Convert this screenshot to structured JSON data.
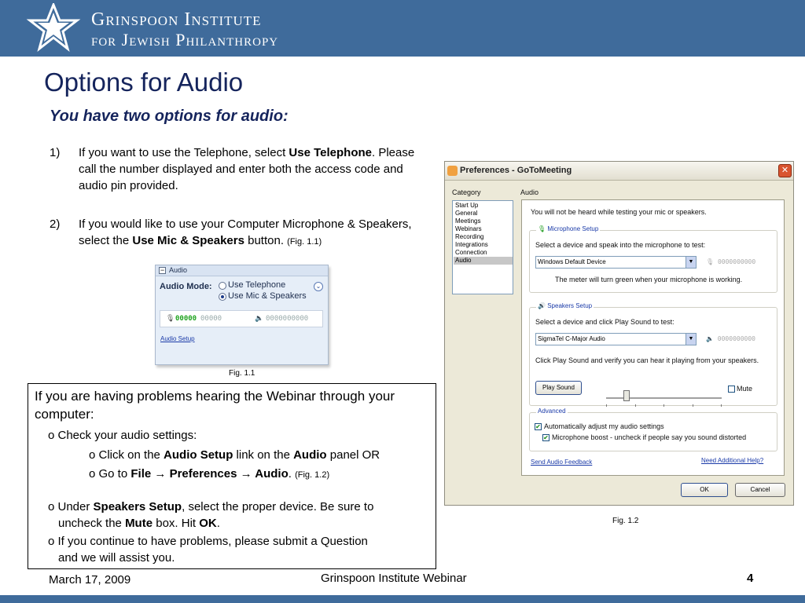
{
  "header": {
    "org_line1": "Grinspoon Institute",
    "org_line2": "for Jewish Philanthropy",
    "brand_color": "#3f6b9b"
  },
  "slide": {
    "title": "Options for Audio",
    "subtitle": "You have two options for audio:"
  },
  "options": [
    {
      "num": "1)",
      "pre": "If you want to use the Telephone, select ",
      "bold": "Use Telephone",
      "post": ".  Please call the number displayed and enter both the access code and audio pin provided."
    },
    {
      "num": "2)",
      "pre": "If you would like to use your Computer Microphone & Speakers, select the ",
      "bold": "Use Mic & Speakers",
      "post": " button. ",
      "fig_ref": "(Fig. 1.1)"
    }
  ],
  "fig11": {
    "panel_title": "Audio",
    "mode_label": "Audio Mode:",
    "option_telephone": "Use Telephone",
    "option_mic": "Use Mic & Speakers",
    "mic_meter": "00000",
    "mic_meter_active": "00000",
    "speaker_meter": "0000000000",
    "link": "Audio Setup",
    "caption": "Fig. 1.1"
  },
  "infobox": {
    "intro": "If you are having problems hearing the Webinar through your computer:",
    "check": "o Check your audio settings:",
    "sub1_pre": "o Click on the ",
    "sub1_b1": "Audio Setup",
    "sub1_mid": " link on the ",
    "sub1_b2": "Audio",
    "sub1_post": " panel OR",
    "sub2_pre": "o Go to ",
    "sub2_b1": "File",
    "sub2_arrow1": " → ",
    "sub2_b2": "Preferences",
    "sub2_arrow2": " → ",
    "sub2_b3": "Audio",
    "sub2_post": ". ",
    "sub2_ref": "(Fig. 1.2)",
    "under_pre": "o Under ",
    "under_b1": "Speakers Setup",
    "under_mid": ", select the proper device.  Be sure to",
    "under_l2_pre": "uncheck the ",
    "under_b2": "Mute",
    "under_l2_mid": " box.  Hit ",
    "under_b3": "OK",
    "under_l2_post": ".",
    "continue_l1": "o If you continue to have problems, please submit a Question",
    "continue_l2": "and we will assist you."
  },
  "dialog": {
    "title": "Preferences - GoToMeeting",
    "category_label": "Category",
    "categories": [
      "Start Up",
      "General",
      "Meetings",
      "Webinars",
      "Recording",
      "Integrations",
      "Connection",
      "Audio"
    ],
    "selected_category": "Audio",
    "section_label": "Audio",
    "notice": "You will not be heard while testing your mic or speakers.",
    "mic_group": "Microphone Setup",
    "mic_instruction": "Select a device and speak into the microphone to test:",
    "mic_device": "Windows Default Device",
    "mic_meter": "0000000000",
    "mic_note": "The meter will turn green when your microphone is working.",
    "spk_group": "Speakers Setup",
    "spk_instruction": "Select a device and click Play Sound to test:",
    "spk_device": "SigmaTel C-Major Audio",
    "spk_meter": "0000000000",
    "spk_note": "Click Play Sound and verify you can hear it playing from your speakers.",
    "play_button": "Play Sound",
    "mute_label": "Mute",
    "adv_group": "Advanced",
    "adv_auto": "Automatically adjust my audio settings",
    "adv_boost": "Microphone boost - uncheck if people say you sound distorted",
    "link_feedback": "Send Audio Feedback",
    "link_help": "Need Additional Help?",
    "ok": "OK",
    "cancel": "Cancel",
    "caption": "Fig. 1.2"
  },
  "footer": {
    "date": "March 17, 2009",
    "center": "Grinspoon Institute Webinar",
    "page": "4"
  }
}
